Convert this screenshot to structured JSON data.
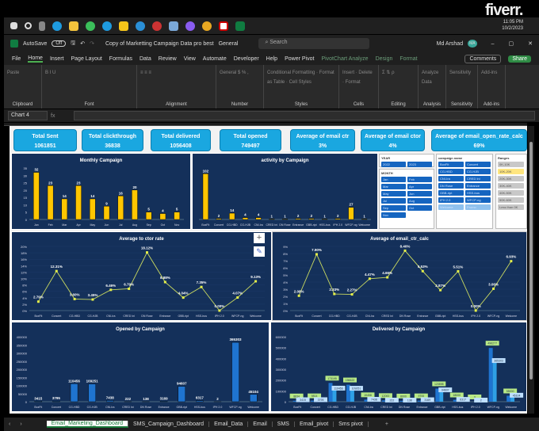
{
  "logo": "fiverr.",
  "clock": {
    "time": "11:05 PM",
    "date": "10/2/2023"
  },
  "titlebar": {
    "autosave": "AutoSave",
    "toggle": "Off",
    "title": "Copy of Marketting Campaign Data pro best",
    "sensitivity": "General",
    "search_placeholder": "Search",
    "user": "Md Arshad",
    "initials": "MA"
  },
  "menu": [
    "File",
    "Home",
    "Insert",
    "Page Layout",
    "Formulas",
    "Data",
    "Review",
    "View",
    "Automate",
    "Developer",
    "Help",
    "Power Pivot",
    "PivotChart Analyze",
    "Design",
    "Format"
  ],
  "menu_buttons": {
    "comments": "Comments",
    "share": "Share"
  },
  "ribbon": [
    {
      "label": "Clipboard",
      "body": "Paste"
    },
    {
      "label": "Font",
      "body": "B  I  U"
    },
    {
      "label": "Alignment",
      "body": "≡ ≡ ≡"
    },
    {
      "label": "Number",
      "body": "General  $ % ,"
    },
    {
      "label": "Styles",
      "body": "Conditional Formatting · Format as Table · Cell Styles"
    },
    {
      "label": "Cells",
      "body": "Insert · Delete · Format"
    },
    {
      "label": "Editing",
      "body": "Σ  ⇅  ρ"
    },
    {
      "label": "Analysis",
      "body": "Analyze Data"
    },
    {
      "label": "Sensitivity",
      "body": "Sensitivity"
    },
    {
      "label": "Add-ins",
      "body": "Add-ins"
    }
  ],
  "formula": {
    "namebox": "Chart 4",
    "fx": "fx"
  },
  "kpis": [
    {
      "title": "Total Sent",
      "value": "1061851"
    },
    {
      "title": "Total clickthrough",
      "value": "36838"
    },
    {
      "title": "Total delivered",
      "value": "1056408"
    },
    {
      "title": "Total opened",
      "value": "749497"
    },
    {
      "title": "Average of email ctr",
      "value": "3%"
    },
    {
      "title": "Average of email ctor",
      "value": "4%"
    },
    {
      "title": "Average of email_open_rate_calc",
      "value": "69%"
    }
  ],
  "slicers": {
    "year": {
      "title": "YEAR",
      "items": [
        "2022",
        "2023"
      ]
    },
    "month": {
      "title": "MONTH",
      "items": [
        "Jan",
        "Feb",
        "Mar",
        "Apr",
        "May",
        "Jun",
        "Jul",
        "Aug",
        "Sep",
        "Oct",
        "Nov"
      ]
    },
    "campaign": {
      "title": "campaign name",
      "items": [
        "BoxFit",
        "Concert",
        "CG-HBD",
        "CG-HJB",
        "CNI-Ira",
        "CRED Ini",
        "DN Rose",
        "Entrance",
        "GBB-ript",
        "HSS-bus",
        "IPH 2.0",
        "WFCP-ng",
        "Welcome",
        "Promo"
      ]
    },
    "ranges": {
      "title": "Ranges",
      "items": [
        "0K-10K",
        "10K-20K",
        "20K-30K",
        "30K-40K",
        "40K-50K",
        "50K-60K",
        "Less than 0K"
      ]
    }
  },
  "colors": {
    "navy": "#14305a",
    "yellow": "#ffc600",
    "blue": "#1f74d0",
    "light_blue": "#2fa0e6",
    "kpi": "#1aa7e0"
  },
  "chart_data": [
    {
      "id": "monthly",
      "type": "bar",
      "title": "Monthly Campaign",
      "categories": [
        "Jan",
        "Feb",
        "Mar",
        "Apr",
        "May",
        "Jun",
        "Jul",
        "Aug",
        "Sep",
        "Oct",
        "Nov"
      ],
      "values": [
        32,
        23,
        14,
        23,
        14,
        9,
        16,
        20,
        5,
        4,
        5
      ],
      "ylim": [
        0,
        35
      ],
      "yticks": [
        0,
        5,
        10,
        15,
        20,
        25,
        30,
        35
      ],
      "color": "#ffc600"
    },
    {
      "id": "activity",
      "type": "bar",
      "title": "activity by Campaign",
      "categories": [
        "BoxFit",
        "Concert",
        "CG-HBD",
        "CG-HJB",
        "CNI-Ira",
        "CRED Ini",
        "DN Rose",
        "Entrance",
        "GBB-ript",
        "HSS-bus",
        "IPH 2.0",
        "WFCP-ng",
        "Welcome"
      ],
      "values": [
        102,
        2,
        14,
        4,
        4,
        1,
        1,
        2,
        2,
        1,
        2,
        27,
        1
      ],
      "ylim": [
        0,
        115
      ],
      "yticks": [],
      "color": "#ffc600"
    },
    {
      "id": "ctor",
      "type": "line",
      "title": "Average to ctor rate",
      "categories": [
        "BoxFit",
        "Concert",
        "CG-HBD",
        "CG-HJB",
        "CNI-Ira",
        "CRED Ini",
        "DN Rose",
        "Entrance",
        "GBB-ript",
        "HSS-bus",
        "IPH 2.0",
        "WFCP-ng",
        "Welcome"
      ],
      "values": [
        2.79,
        12.31,
        3.6,
        3.45,
        6.46,
        6.79,
        18.12,
        8.88,
        4.04,
        7.35,
        0.0,
        4.07,
        9.13
      ],
      "ylim": [
        0,
        20
      ],
      "yticks": [
        0,
        2,
        4,
        6,
        8,
        10,
        12,
        14,
        16,
        18,
        20
      ],
      "unit": "%",
      "color": "#c8d860"
    },
    {
      "id": "ctr",
      "type": "line",
      "title": "Average of email_ctr_calc",
      "categories": [
        "BoxFit",
        "Concert",
        "CG-HBD",
        "CG-HJB",
        "CNI-Ira",
        "CRED Ini",
        "DN Rose",
        "Entrance",
        "GBB-ript",
        "HSS-bus",
        "IPH 2.0",
        "WFCP-ng",
        "Welcome"
      ],
      "values": [
        2.08,
        7.9,
        2.33,
        2.27,
        4.47,
        4.66,
        8.4,
        5.53,
        2.87,
        5.51,
        0.0,
        3.06,
        6.93
      ],
      "ylim": [
        0,
        9
      ],
      "yticks": [
        0,
        1,
        2,
        3,
        4,
        5,
        6,
        7,
        8,
        9
      ],
      "unit": "%",
      "color": "#c8d860"
    },
    {
      "id": "opened",
      "type": "bar",
      "title": "Opened by Campaign",
      "categories": [
        "BoxFit",
        "Concert",
        "CG-HBD",
        "CG-HJB",
        "CNI-Ira",
        "CRED Ini",
        "DN Rose",
        "Entrance",
        "GBB-ript",
        "HSS-bus",
        "IPH 2.0",
        "WFCP-ng",
        "Welcome"
      ],
      "values": [
        3415,
        3795,
        110456,
        109251,
        7438,
        222,
        138,
        3169,
        94607,
        6317,
        2,
        365303,
        45104
      ],
      "ylim": [
        0,
        400000
      ],
      "yticks": [
        0,
        50000,
        100000,
        150000,
        200000,
        250000,
        300000,
        350000,
        400000
      ],
      "color": "#1f74d0"
    },
    {
      "id": "delivered",
      "type": "bar",
      "title": "Delivered by Campaign",
      "categories": [
        "BoxFit",
        "Concert",
        "CG-HBD",
        "CG-HJB",
        "CNI-Ira",
        "CRED Ini",
        "DN Rose",
        "Entrance",
        "GBB-ript",
        "HSS-bus",
        "IPH 2.0",
        "WFCP-ng",
        "Welcome"
      ],
      "series": [
        {
          "name": "delivered",
          "values": [
            8834,
            9814,
            173195,
            156622,
            19458,
            12000,
            8000,
            9700,
            120898,
            18000,
            3,
            496277,
            55000
          ],
          "color": "#1f74d0",
          "label_bg": "#b8e986"
        },
        {
          "name": "opened",
          "values": [
            3415,
            3795,
            110456,
            109251,
            7438,
            222,
            138,
            3169,
            94607,
            6317,
            2,
            365303,
            45104
          ],
          "color": "#2fa0e6",
          "label_bg": "#bfe0ff"
        }
      ],
      "ylim": [
        0,
        600000
      ],
      "yticks": [
        0,
        100000,
        200000,
        300000,
        400000,
        500000,
        600000
      ]
    }
  ],
  "sheet_tabs": [
    "Email_Marketing_Dashboard",
    "SMS_Campaign_Dashboard",
    "Email_Data",
    "Email",
    "SMS",
    "Email_pivot",
    "Sms pivot"
  ],
  "add_sheet": "+"
}
